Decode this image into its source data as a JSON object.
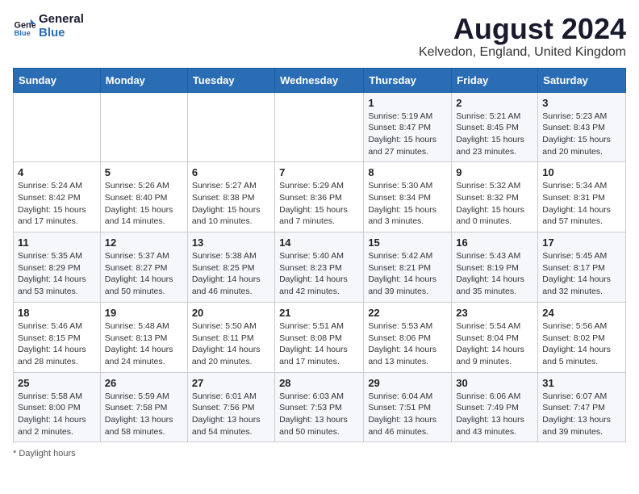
{
  "header": {
    "logo_line1": "General",
    "logo_line2": "Blue",
    "month_title": "August 2024",
    "location": "Kelvedon, England, United Kingdom"
  },
  "days_of_week": [
    "Sunday",
    "Monday",
    "Tuesday",
    "Wednesday",
    "Thursday",
    "Friday",
    "Saturday"
  ],
  "weeks": [
    [
      {
        "day": "",
        "sunrise": "",
        "sunset": "",
        "daylight": ""
      },
      {
        "day": "",
        "sunrise": "",
        "sunset": "",
        "daylight": ""
      },
      {
        "day": "",
        "sunrise": "",
        "sunset": "",
        "daylight": ""
      },
      {
        "day": "",
        "sunrise": "",
        "sunset": "",
        "daylight": ""
      },
      {
        "day": "1",
        "sunrise": "Sunrise: 5:19 AM",
        "sunset": "Sunset: 8:47 PM",
        "daylight": "Daylight: 15 hours and 27 minutes."
      },
      {
        "day": "2",
        "sunrise": "Sunrise: 5:21 AM",
        "sunset": "Sunset: 8:45 PM",
        "daylight": "Daylight: 15 hours and 23 minutes."
      },
      {
        "day": "3",
        "sunrise": "Sunrise: 5:23 AM",
        "sunset": "Sunset: 8:43 PM",
        "daylight": "Daylight: 15 hours and 20 minutes."
      }
    ],
    [
      {
        "day": "4",
        "sunrise": "Sunrise: 5:24 AM",
        "sunset": "Sunset: 8:42 PM",
        "daylight": "Daylight: 15 hours and 17 minutes."
      },
      {
        "day": "5",
        "sunrise": "Sunrise: 5:26 AM",
        "sunset": "Sunset: 8:40 PM",
        "daylight": "Daylight: 15 hours and 14 minutes."
      },
      {
        "day": "6",
        "sunrise": "Sunrise: 5:27 AM",
        "sunset": "Sunset: 8:38 PM",
        "daylight": "Daylight: 15 hours and 10 minutes."
      },
      {
        "day": "7",
        "sunrise": "Sunrise: 5:29 AM",
        "sunset": "Sunset: 8:36 PM",
        "daylight": "Daylight: 15 hours and 7 minutes."
      },
      {
        "day": "8",
        "sunrise": "Sunrise: 5:30 AM",
        "sunset": "Sunset: 8:34 PM",
        "daylight": "Daylight: 15 hours and 3 minutes."
      },
      {
        "day": "9",
        "sunrise": "Sunrise: 5:32 AM",
        "sunset": "Sunset: 8:32 PM",
        "daylight": "Daylight: 15 hours and 0 minutes."
      },
      {
        "day": "10",
        "sunrise": "Sunrise: 5:34 AM",
        "sunset": "Sunset: 8:31 PM",
        "daylight": "Daylight: 14 hours and 57 minutes."
      }
    ],
    [
      {
        "day": "11",
        "sunrise": "Sunrise: 5:35 AM",
        "sunset": "Sunset: 8:29 PM",
        "daylight": "Daylight: 14 hours and 53 minutes."
      },
      {
        "day": "12",
        "sunrise": "Sunrise: 5:37 AM",
        "sunset": "Sunset: 8:27 PM",
        "daylight": "Daylight: 14 hours and 50 minutes."
      },
      {
        "day": "13",
        "sunrise": "Sunrise: 5:38 AM",
        "sunset": "Sunset: 8:25 PM",
        "daylight": "Daylight: 14 hours and 46 minutes."
      },
      {
        "day": "14",
        "sunrise": "Sunrise: 5:40 AM",
        "sunset": "Sunset: 8:23 PM",
        "daylight": "Daylight: 14 hours and 42 minutes."
      },
      {
        "day": "15",
        "sunrise": "Sunrise: 5:42 AM",
        "sunset": "Sunset: 8:21 PM",
        "daylight": "Daylight: 14 hours and 39 minutes."
      },
      {
        "day": "16",
        "sunrise": "Sunrise: 5:43 AM",
        "sunset": "Sunset: 8:19 PM",
        "daylight": "Daylight: 14 hours and 35 minutes."
      },
      {
        "day": "17",
        "sunrise": "Sunrise: 5:45 AM",
        "sunset": "Sunset: 8:17 PM",
        "daylight": "Daylight: 14 hours and 32 minutes."
      }
    ],
    [
      {
        "day": "18",
        "sunrise": "Sunrise: 5:46 AM",
        "sunset": "Sunset: 8:15 PM",
        "daylight": "Daylight: 14 hours and 28 minutes."
      },
      {
        "day": "19",
        "sunrise": "Sunrise: 5:48 AM",
        "sunset": "Sunset: 8:13 PM",
        "daylight": "Daylight: 14 hours and 24 minutes."
      },
      {
        "day": "20",
        "sunrise": "Sunrise: 5:50 AM",
        "sunset": "Sunset: 8:11 PM",
        "daylight": "Daylight: 14 hours and 20 minutes."
      },
      {
        "day": "21",
        "sunrise": "Sunrise: 5:51 AM",
        "sunset": "Sunset: 8:08 PM",
        "daylight": "Daylight: 14 hours and 17 minutes."
      },
      {
        "day": "22",
        "sunrise": "Sunrise: 5:53 AM",
        "sunset": "Sunset: 8:06 PM",
        "daylight": "Daylight: 14 hours and 13 minutes."
      },
      {
        "day": "23",
        "sunrise": "Sunrise: 5:54 AM",
        "sunset": "Sunset: 8:04 PM",
        "daylight": "Daylight: 14 hours and 9 minutes."
      },
      {
        "day": "24",
        "sunrise": "Sunrise: 5:56 AM",
        "sunset": "Sunset: 8:02 PM",
        "daylight": "Daylight: 14 hours and 5 minutes."
      }
    ],
    [
      {
        "day": "25",
        "sunrise": "Sunrise: 5:58 AM",
        "sunset": "Sunset: 8:00 PM",
        "daylight": "Daylight: 14 hours and 2 minutes."
      },
      {
        "day": "26",
        "sunrise": "Sunrise: 5:59 AM",
        "sunset": "Sunset: 7:58 PM",
        "daylight": "Daylight: 13 hours and 58 minutes."
      },
      {
        "day": "27",
        "sunrise": "Sunrise: 6:01 AM",
        "sunset": "Sunset: 7:56 PM",
        "daylight": "Daylight: 13 hours and 54 minutes."
      },
      {
        "day": "28",
        "sunrise": "Sunrise: 6:03 AM",
        "sunset": "Sunset: 7:53 PM",
        "daylight": "Daylight: 13 hours and 50 minutes."
      },
      {
        "day": "29",
        "sunrise": "Sunrise: 6:04 AM",
        "sunset": "Sunset: 7:51 PM",
        "daylight": "Daylight: 13 hours and 46 minutes."
      },
      {
        "day": "30",
        "sunrise": "Sunrise: 6:06 AM",
        "sunset": "Sunset: 7:49 PM",
        "daylight": "Daylight: 13 hours and 43 minutes."
      },
      {
        "day": "31",
        "sunrise": "Sunrise: 6:07 AM",
        "sunset": "Sunset: 7:47 PM",
        "daylight": "Daylight: 13 hours and 39 minutes."
      }
    ]
  ],
  "footer": "* Daylight hours"
}
